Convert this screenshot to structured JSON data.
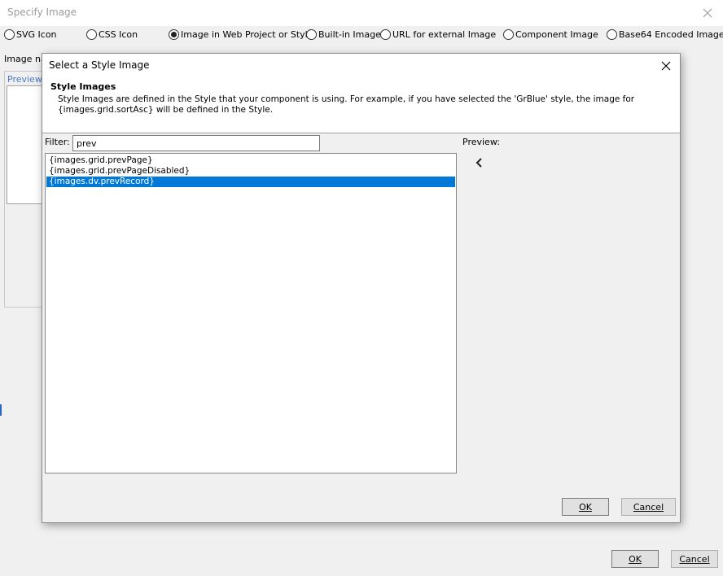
{
  "outer": {
    "title": "Specify Image",
    "radios": [
      {
        "label": "SVG Icon",
        "checked": false
      },
      {
        "label": "CSS Icon",
        "checked": false
      },
      {
        "label": "Image in Web Project or Style",
        "checked": true
      },
      {
        "label": "Built-in Image",
        "checked": false
      },
      {
        "label": "URL for external Image",
        "checked": false
      },
      {
        "label": "Component Image",
        "checked": false
      },
      {
        "label": "Base64 Encoded Image",
        "checked": false
      }
    ],
    "image_name_label": "Image nam",
    "preview_link": "Preview",
    "ok_label": "OK",
    "cancel_label": "Cancel"
  },
  "dialog": {
    "title": "Select a Style Image",
    "header_title": "Style Images",
    "header_desc": "Style Images are defined in the Style that your component is using. For example, if you have selected the 'GrBlue' style, the image for {images.grid.sortAsc} will be defined in the Style.",
    "filter_label": "Filter:",
    "filter_value": "prev",
    "preview_label": "Preview:",
    "preview_icon": "chevron-left-icon",
    "items": [
      {
        "label": "{images.grid.prevPage}",
        "selected": false
      },
      {
        "label": "{images.grid.prevPageDisabled}",
        "selected": false
      },
      {
        "label": "{images.dv.prevRecord}",
        "selected": true
      }
    ],
    "ok_label": "OK",
    "cancel_label": "Cancel"
  },
  "colors": {
    "selection": "#0078d7",
    "link": "#4a7ac9"
  }
}
